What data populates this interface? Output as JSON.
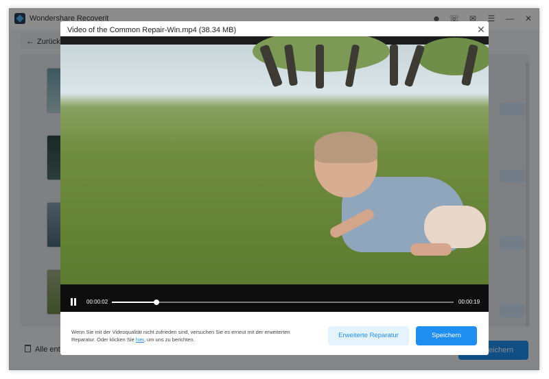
{
  "app": {
    "title": "Wondershare Recoverit",
    "back_label": "Zurück",
    "remove_all_label": "Alle entf",
    "save_label": "peichern"
  },
  "titlebar_icons": [
    "user-icon",
    "headset-icon",
    "mail-icon",
    "menu-icon",
    "minimize-icon",
    "close-icon"
  ],
  "modal": {
    "title": "Video of the Common Repair-Win.mp4 (38.34  MB)",
    "player": {
      "current_time": "00:00:02",
      "duration": "00:00:19",
      "progress": 0.13
    },
    "message_before_link": "Wenn Sie mit der Videoqualität nicht zufrieden sind, versuchen Sie es erneut mit der erweiterten Reparatur. Oder klicken Sie ",
    "link_text": "hier",
    "message_after_link": ", um uns zu berichten.",
    "advanced_repair_label": "Erweiterte Reparatur",
    "save_label": "Speichern"
  },
  "colors": {
    "accent": "#1f8ef1",
    "accent_light": "#e5f3fd"
  }
}
